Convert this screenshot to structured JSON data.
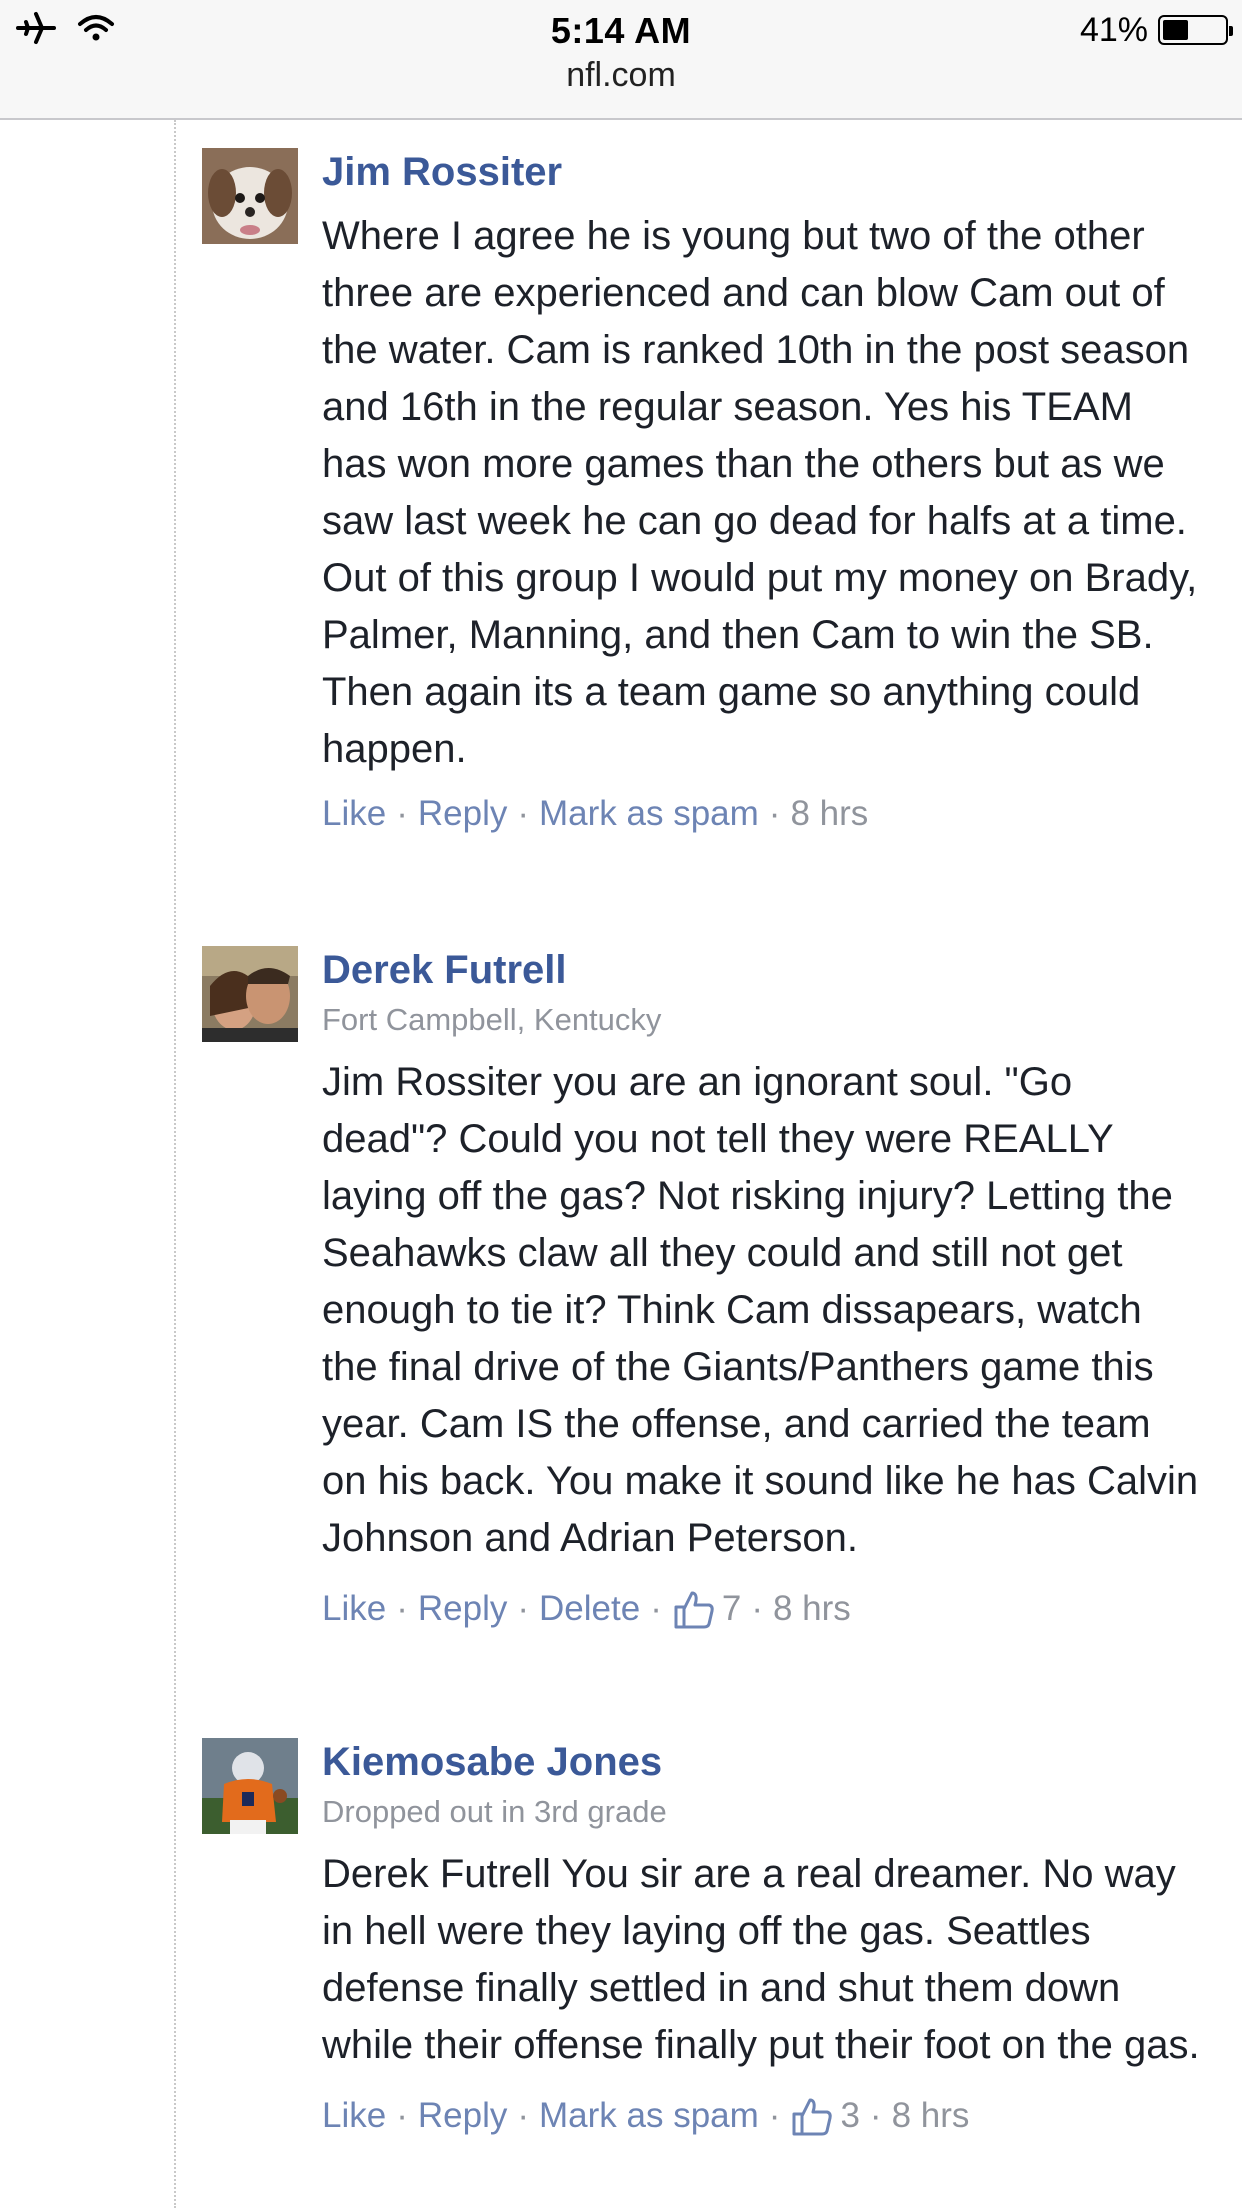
{
  "status_bar": {
    "time": "5:14 AM",
    "battery": "41%",
    "battery_level": 0.41,
    "icons": [
      "airplane-icon",
      "wifi-icon"
    ]
  },
  "browser": {
    "url": "nfl.com"
  },
  "colors": {
    "link": "#3b5998",
    "action": "#6d84b4",
    "meta": "#90949c",
    "text": "#1d2129"
  },
  "comments": [
    {
      "author": "Jim Rossiter",
      "text": "Where I agree he is young but two of the other three are experienced and can blow Cam out of the water. Cam is ranked 10th in the post season and 16th in the regular season. Yes his TEAM has won more games than the others but as we saw last week he can go dead for halfs at a time. Out of this group I would put my money on Brady, Palmer, Manning, and then Cam to win the SB. Then again its a team game so anything could happen.",
      "actions": {
        "like": "Like",
        "reply": "Reply",
        "third": "Mark as spam",
        "time": "8 hrs"
      }
    },
    {
      "author": "Derek Futrell",
      "subtitle": "Fort Campbell, Kentucky",
      "text": "Jim Rossiter you are an ignorant soul. \"Go dead\"? Could you not tell they were REALLY laying off the gas? Not risking injury? Letting the Seahawks claw all they could and still not get enough to tie it? Think Cam dissapears, watch the final drive of the Giants/Panthers game this year. Cam IS the offense, and carried the team on his back. You make it sound like he has Calvin Johnson and Adrian Peterson.",
      "actions": {
        "like": "Like",
        "reply": "Reply",
        "third": "Delete",
        "likes": "7",
        "time": "8 hrs"
      }
    },
    {
      "author": "Kiemosabe Jones",
      "subtitle": "Dropped out in 3rd grade",
      "text": "Derek Futrell You sir are a real dreamer. No way in hell were they laying off the gas. Seattles defense finally settled in and shut them down while their offense finally put their foot on the gas.",
      "actions": {
        "like": "Like",
        "reply": "Reply",
        "third": "Mark as spam",
        "likes": "3",
        "time": "8 hrs"
      }
    }
  ]
}
